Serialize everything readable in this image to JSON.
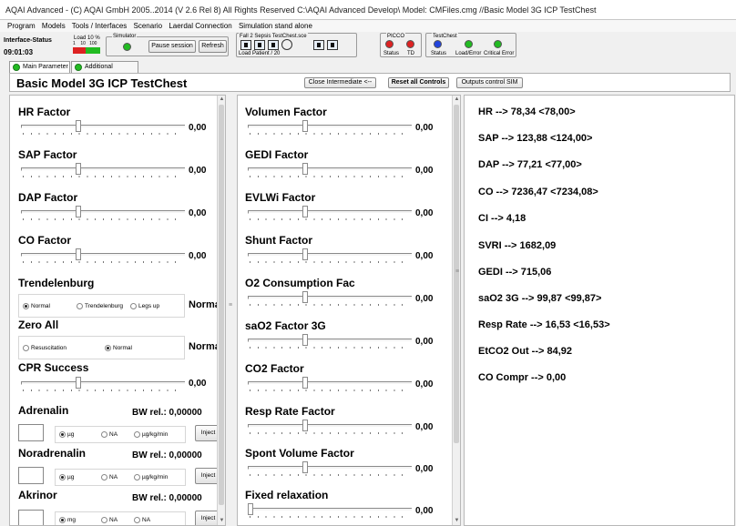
{
  "window": {
    "title": "AQAI Advanced - (C) AQAI GmbH 2005..2014 (V 2.6 Rel 8) All Rights Reserved  C:\\AQAI Advanced Develop\\    Model: CMFiles.cmg //Basic Model 3G ICP TestChest"
  },
  "menu": [
    "Program",
    "Models",
    "Tools / Interfaces",
    "Scenario",
    "Laerdal Connection",
    "Simulation stand alone"
  ],
  "toolbar": {
    "interface_status_label": "Interface-Status",
    "time": "09:01:03",
    "load_label": "Load 10 %",
    "load_scale": "1    10   100",
    "simulator_label": "Simulator",
    "pause_label": "Pause session",
    "refresh_label": "Refresh",
    "sepsis_label": "Fall 2 Sepsis TestChest.sce",
    "load_patient": "Load Patient / 20",
    "picco_label": "PICCO",
    "picco_status": "Status",
    "picco_td": "TD",
    "testchest_label": "TestChest",
    "tc_status": "Status",
    "tc_load_error": "Load/Error",
    "tc_critical_error": "Critical Error"
  },
  "colors": {
    "led_green": "#22bb22",
    "led_red": "#dd2222",
    "led_blue": "#2244dd",
    "load_red": "#dd2222",
    "load_green": "#22bb22"
  },
  "tabs": [
    {
      "label": "Main Parameter"
    },
    {
      "label": "Additional Parameter"
    }
  ],
  "header": {
    "title": "Basic Model 3G ICP TestChest",
    "close_intermediate": "Close Intermediate <--",
    "reset_all": "Reset all Controls",
    "outputs_control": "Outputs control SIM"
  },
  "left": {
    "factors": [
      {
        "label": "HR Factor",
        "value": "0,00"
      },
      {
        "label": "SAP Factor",
        "value": "0,00"
      },
      {
        "label": "DAP Factor",
        "value": "0,00"
      },
      {
        "label": "CO Factor",
        "value": "0,00"
      }
    ],
    "trendelenburg": {
      "label": "Trendelenburg",
      "options": [
        "Normal",
        "Trendelenburg",
        "Legs up"
      ],
      "value": "Normal"
    },
    "zero_all": {
      "label": "Zero All",
      "options": [
        "Resuscitation",
        "Normal"
      ],
      "value": "Normal"
    },
    "cpr": {
      "label": "CPR Success",
      "value": "0,00"
    },
    "drugs": [
      {
        "label": "Adrenalin",
        "bw": "BW rel.: 0,00000",
        "units": [
          "µg",
          "NA",
          "µg/kg/min"
        ],
        "inject": "Inject"
      },
      {
        "label": "Noradrenalin",
        "bw": "BW rel.: 0,00000",
        "units": [
          "µg",
          "NA",
          "µg/kg/min"
        ],
        "inject": "Inject"
      },
      {
        "label": "Akrinor",
        "bw": "BW rel.: 0,00000",
        "units": [
          "mg",
          "NA",
          "NA"
        ],
        "inject": "Inject"
      }
    ]
  },
  "middle": {
    "factors": [
      {
        "label": "Volumen Factor",
        "value": "0,00"
      },
      {
        "label": "GEDI Factor",
        "value": "0,00"
      },
      {
        "label": "EVLWi Factor",
        "value": "0,00"
      },
      {
        "label": "Shunt Factor",
        "value": "0,00"
      },
      {
        "label": "O2 Consumption Fac",
        "value": "0,00"
      },
      {
        "label": "saO2 Factor 3G",
        "value": "0,00"
      },
      {
        "label": "CO2 Factor",
        "value": "0,00"
      },
      {
        "label": "Resp Rate Factor",
        "value": "0,00"
      },
      {
        "label": "Spont Volume Factor",
        "value": "0,00"
      },
      {
        "label": "Fixed relaxation",
        "value": "0,00"
      }
    ]
  },
  "outputs": [
    "HR --> 78,34 <78,00>",
    "SAP --> 123,88 <124,00>",
    "DAP --> 77,21 <77,00>",
    "CO --> 7236,47 <7234,08>",
    "CI --> 4,18",
    "SVRI --> 1682,09",
    "GEDI --> 715,06",
    "saO2 3G --> 99,87 <99,87>",
    "Resp Rate --> 16,53 <16,53>",
    "EtCO2 Out --> 84,92",
    "CO Compr --> 0,00"
  ]
}
